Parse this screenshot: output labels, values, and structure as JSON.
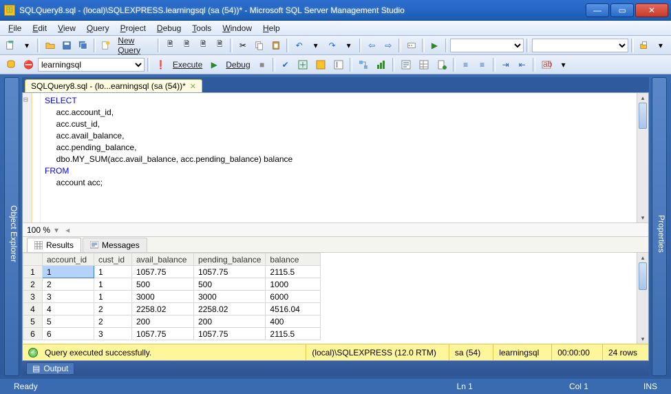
{
  "window": {
    "title": "SQLQuery8.sql - (local)\\SQLEXPRESS.learningsql (sa (54))* - Microsoft SQL Server Management Studio"
  },
  "menu": [
    "File",
    "Edit",
    "View",
    "Query",
    "Project",
    "Debug",
    "Tools",
    "Window",
    "Help"
  ],
  "toolbar1": {
    "new_query": "New Query"
  },
  "toolbar2": {
    "db_selected": "learningsql",
    "execute": "Execute",
    "debug": "Debug"
  },
  "document_tab": {
    "label": "SQLQuery8.sql - (lo...earningsql (sa (54))*"
  },
  "code": {
    "line1": "SELECT",
    "line2": "     acc.account_id,",
    "line3": "     acc.cust_id,",
    "line4": "     acc.avail_balance,",
    "line5": "     acc.pending_balance,",
    "line6": "     dbo.MY_SUM(acc.avail_balance, acc.pending_balance) balance",
    "line7": "FROM",
    "line8": "     account acc;"
  },
  "zoom": "100 %",
  "result_tabs": {
    "results": "Results",
    "messages": "Messages"
  },
  "grid": {
    "columns": [
      "account_id",
      "cust_id",
      "avail_balance",
      "pending_balance",
      "balance"
    ],
    "rows": [
      {
        "n": "1",
        "account_id": "1",
        "cust_id": "1",
        "avail_balance": "1057.75",
        "pending_balance": "1057.75",
        "balance": "2115.5"
      },
      {
        "n": "2",
        "account_id": "2",
        "cust_id": "1",
        "avail_balance": "500",
        "pending_balance": "500",
        "balance": "1000"
      },
      {
        "n": "3",
        "account_id": "3",
        "cust_id": "1",
        "avail_balance": "3000",
        "pending_balance": "3000",
        "balance": "6000"
      },
      {
        "n": "4",
        "account_id": "4",
        "cust_id": "2",
        "avail_balance": "2258.02",
        "pending_balance": "2258.02",
        "balance": "4516.04"
      },
      {
        "n": "5",
        "account_id": "5",
        "cust_id": "2",
        "avail_balance": "200",
        "pending_balance": "200",
        "balance": "400"
      },
      {
        "n": "6",
        "account_id": "6",
        "cust_id": "3",
        "avail_balance": "1057.75",
        "pending_balance": "1057.75",
        "balance": "2115.5"
      }
    ]
  },
  "status_exec": {
    "message": "Query executed successfully.",
    "server": "(local)\\SQLEXPRESS (12.0 RTM)",
    "user": "sa (54)",
    "db": "learningsql",
    "time": "00:00:00",
    "rows": "24 rows"
  },
  "side_panels": {
    "left": "Object Explorer",
    "right": "Properties"
  },
  "output_tab": "Output",
  "statusbar": {
    "ready": "Ready",
    "ln": "Ln 1",
    "col": "Col 1",
    "ins": "INS"
  }
}
